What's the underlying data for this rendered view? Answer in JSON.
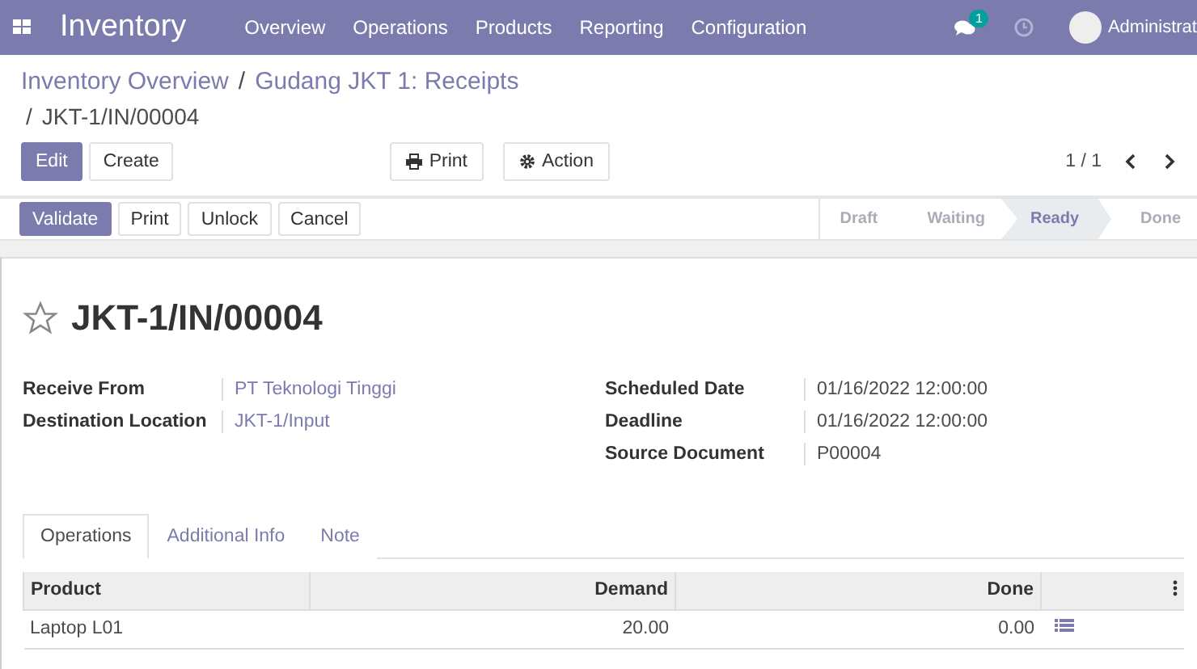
{
  "navbar": {
    "app_name": "Inventory",
    "menu": [
      "Overview",
      "Operations",
      "Products",
      "Reporting",
      "Configuration"
    ],
    "message_count": "1",
    "user": "Administrat"
  },
  "breadcrumb": {
    "items": [
      "Inventory Overview",
      "Gudang JKT 1: Receipts"
    ],
    "separators": [
      "/",
      "/"
    ],
    "current": "JKT-1/IN/00004"
  },
  "control_buttons": [
    {
      "label": "Edit",
      "kind": "primary"
    },
    {
      "label": "Create",
      "kind": "default"
    }
  ],
  "action_buttons": [
    {
      "label": "Print",
      "kind": "print"
    },
    {
      "label": "Action",
      "kind": "gear"
    }
  ],
  "pager": "1 / 1",
  "header_buttons": [
    {
      "label": "Validate",
      "kind": "primary"
    },
    {
      "label": "Print",
      "kind": "default"
    },
    {
      "label": "Unlock",
      "kind": "default"
    },
    {
      "label": "Cancel",
      "kind": "default"
    }
  ],
  "stages": [
    {
      "label": "Draft",
      "selected": false
    },
    {
      "label": "Waiting",
      "selected": false
    },
    {
      "label": "Ready",
      "selected": true
    },
    {
      "label": "Done",
      "selected": false
    }
  ],
  "record": {
    "title": "JKT-1/IN/00004",
    "starred": false
  },
  "left_fields": [
    {
      "label": "Receive From",
      "value": "PT Teknologi Tinggi"
    },
    {
      "label": "Destination Location",
      "value": "JKT-1/Input"
    }
  ],
  "right_fields": [
    {
      "label": "Scheduled Date",
      "value": "01/16/2022 12:00:00"
    },
    {
      "label": "Deadline",
      "value": "01/16/2022 12:00:00"
    },
    {
      "label": "Source Document",
      "value": "P00004"
    }
  ],
  "tabs": [
    {
      "label": "Operations",
      "selected": true
    },
    {
      "label": "Additional Info",
      "selected": false
    },
    {
      "label": "Note",
      "selected": false
    }
  ],
  "table": {
    "columns": [
      "Product",
      "Demand",
      "Done"
    ],
    "rows": [
      {
        "product": "Laptop L01",
        "demand": "20.00",
        "done": "0.00"
      }
    ]
  }
}
